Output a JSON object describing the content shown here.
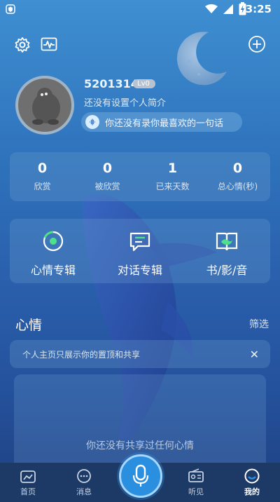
{
  "status_bar": {
    "time": "3:25"
  },
  "profile": {
    "username": "5201314",
    "level": "Lv0",
    "bio": "还没有设置个人简介",
    "quote_prompt": "你还没有录你最喜欢的一句话"
  },
  "stats": [
    {
      "value": "0",
      "label": "欣赏"
    },
    {
      "value": "0",
      "label": "被欣赏"
    },
    {
      "value": "1",
      "label": "已来天数"
    },
    {
      "value": "0",
      "label": "总心情(秒)"
    }
  ],
  "features": [
    {
      "label": "心情专辑",
      "icon": "mood-album-icon"
    },
    {
      "label": "对话专辑",
      "icon": "dialog-album-icon"
    },
    {
      "label": "书/影/音",
      "icon": "book-film-music-icon"
    }
  ],
  "mood": {
    "title": "心情",
    "filter_label": "筛选",
    "notice": "个人主页只展示你的置顶和共享",
    "empty_text": "你还没有共享过任何心情"
  },
  "nav": [
    {
      "label": "首页",
      "icon": "home-icon"
    },
    {
      "label": "消息",
      "icon": "message-icon"
    },
    {
      "label": "听见",
      "icon": "radio-icon"
    },
    {
      "label": "我的",
      "icon": "profile-icon"
    }
  ],
  "colors": {
    "background_top": "#3f8fd2",
    "background_bottom": "#1f3f7e",
    "accent": "#2b8fe0",
    "nav_background": "#1d3a66"
  }
}
